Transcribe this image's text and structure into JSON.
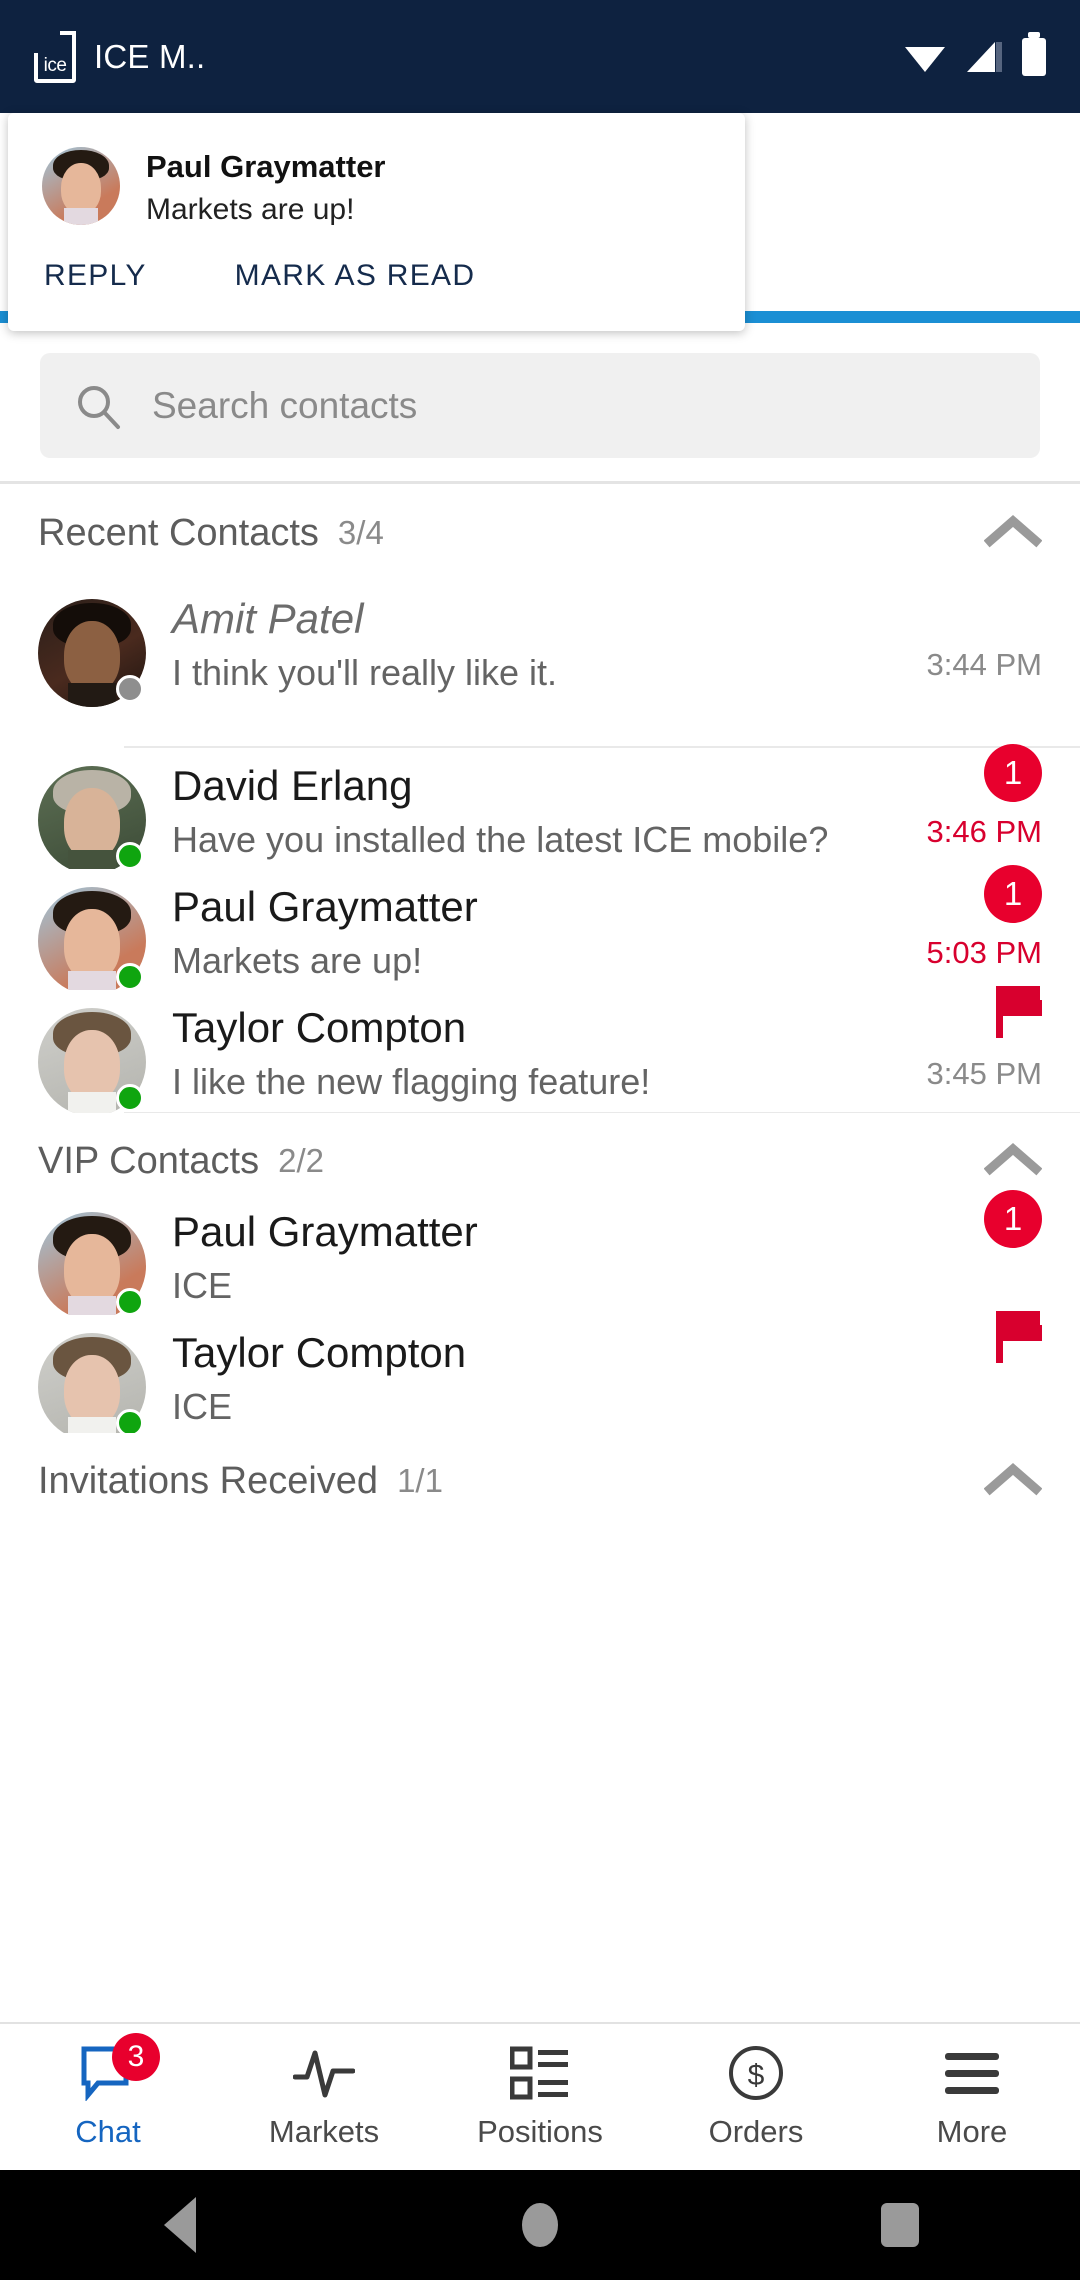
{
  "status_bar": {
    "app_badge_text": "ice",
    "title": "ICE M..",
    "icons": [
      "wifi-icon",
      "cellular-signal-icon",
      "battery-icon"
    ]
  },
  "notification": {
    "sender": "Paul Graymatter",
    "message": "Markets are up!",
    "reply_label": "REPLY",
    "mark_as_read_label": "MARK AS READ",
    "accent_color": "#1B8FD4"
  },
  "search": {
    "placeholder": "Search contacts",
    "icon": "search-icon"
  },
  "sections": [
    {
      "title": "Recent Contacts",
      "count": "3/4",
      "collapse_icon": "chevron-up-icon",
      "rows": [
        {
          "name": "Amit Patel",
          "subtitle": "I think you'll really like it.",
          "time": "3:44 PM",
          "time_alert": false,
          "presence": "offline",
          "badge": null,
          "flag": false,
          "muted": true
        },
        {
          "name": "David Erlang",
          "subtitle": "Have you installed the latest ICE mobile?",
          "time": "3:46 PM",
          "time_alert": true,
          "presence": "online",
          "badge": "1",
          "flag": false,
          "muted": false
        },
        {
          "name": "Paul Graymatter",
          "subtitle": "Markets are up!",
          "time": "5:03 PM",
          "time_alert": true,
          "presence": "online",
          "badge": "1",
          "flag": false,
          "muted": false
        },
        {
          "name": "Taylor Compton",
          "subtitle": "I like the new flagging feature!",
          "time": "3:45 PM",
          "time_alert": false,
          "presence": "online",
          "badge": null,
          "flag": true,
          "muted": false
        }
      ]
    },
    {
      "title": "VIP Contacts",
      "count": "2/2",
      "collapse_icon": "chevron-up-icon",
      "rows": [
        {
          "name": "Paul Graymatter",
          "subtitle": "ICE",
          "time": null,
          "time_alert": false,
          "presence": "online",
          "badge": "1",
          "flag": false,
          "muted": false
        },
        {
          "name": "Taylor Compton",
          "subtitle": "ICE",
          "time": null,
          "time_alert": false,
          "presence": "online",
          "badge": null,
          "flag": true,
          "muted": false
        }
      ]
    },
    {
      "title": "Invitations Received",
      "count": "1/1",
      "collapse_icon": "chevron-up-icon",
      "rows": []
    }
  ],
  "bottom_nav": {
    "items": [
      {
        "label": "Chat",
        "icon": "chat-bubble-icon",
        "active": true,
        "badge": "3"
      },
      {
        "label": "Markets",
        "icon": "pulse-line-icon",
        "active": false,
        "badge": null
      },
      {
        "label": "Positions",
        "icon": "list-grid-icon",
        "active": false,
        "badge": null
      },
      {
        "label": "Orders",
        "icon": "dollar-circle-icon",
        "active": false,
        "badge": null
      },
      {
        "label": "More",
        "icon": "hamburger-icon",
        "active": false,
        "badge": null
      }
    ]
  },
  "system_nav": {
    "back": "back-triangle-icon",
    "home": "home-circle-icon",
    "recents": "recents-square-icon"
  },
  "colors": {
    "status_bar_bg": "#0E2240",
    "accent_blue": "#1B8FD4",
    "badge_red": "#E8002D",
    "alert_red": "#D8002E",
    "online_green": "#0FA50F",
    "offline_gray": "#8E8E8E",
    "active_nav": "#1565C0"
  }
}
